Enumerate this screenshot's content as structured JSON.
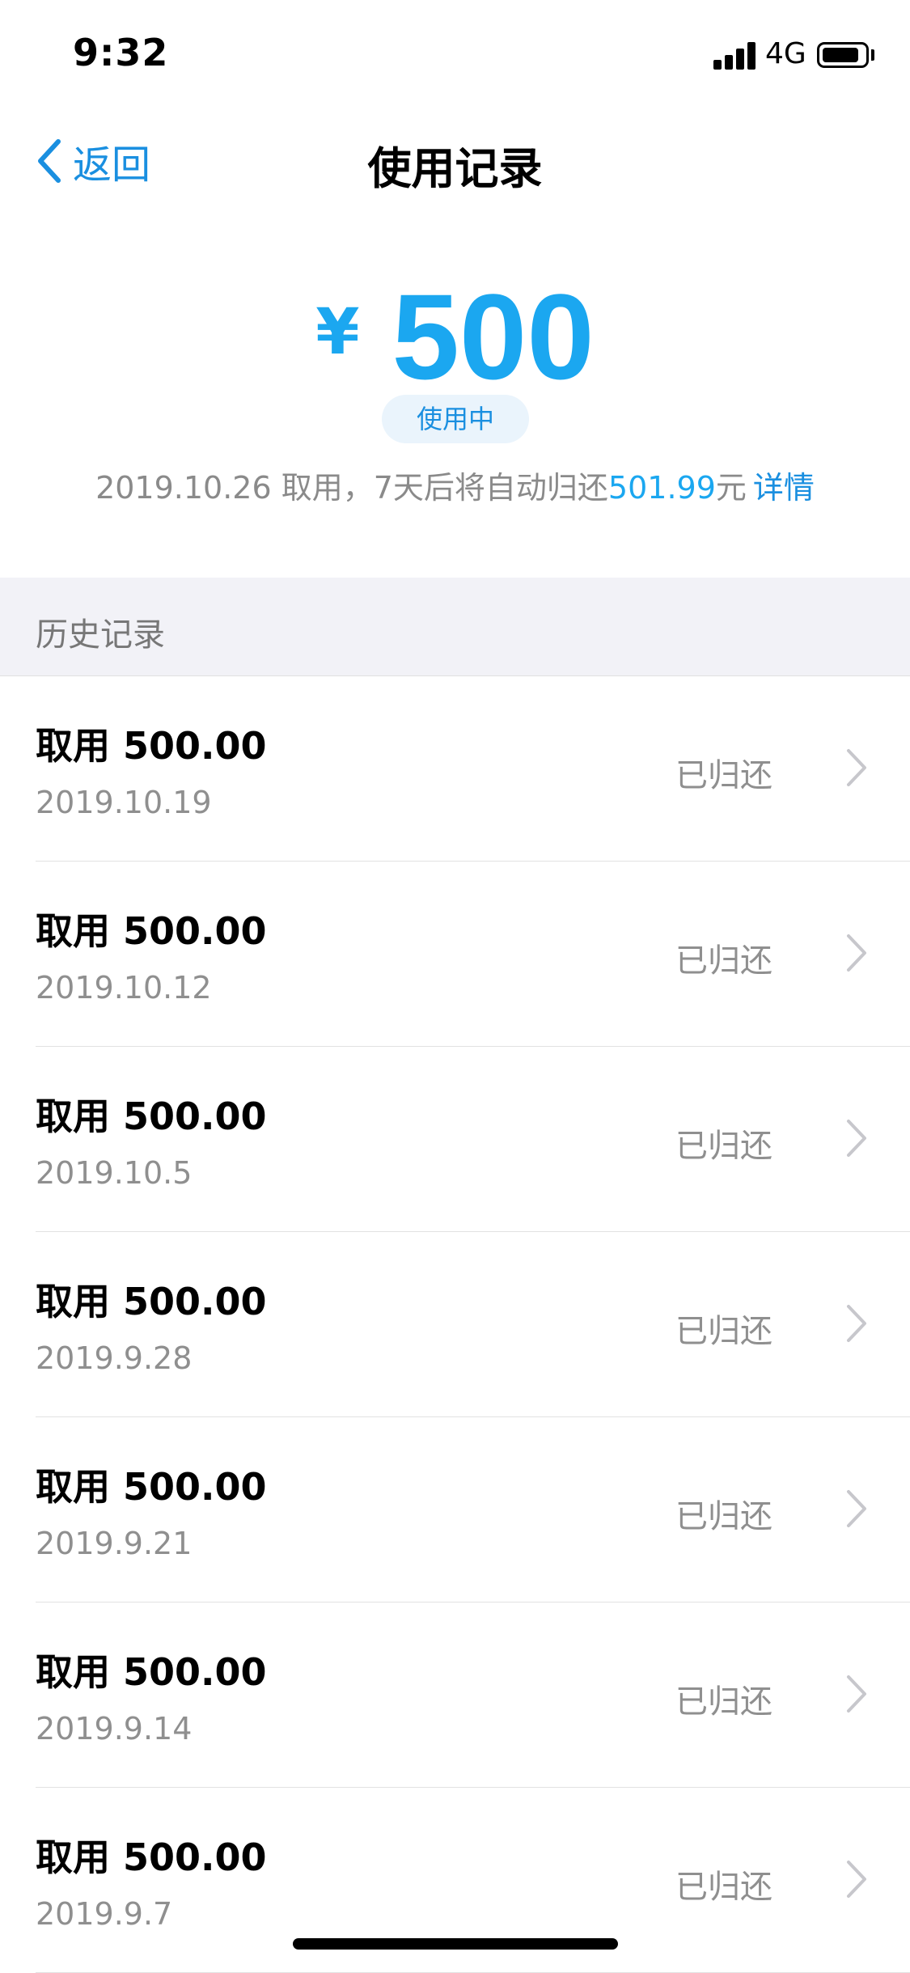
{
  "status_bar": {
    "time": "9:32",
    "network": "4G"
  },
  "nav": {
    "back_label": "返回",
    "title": "使用记录"
  },
  "summary": {
    "currency": "¥",
    "amount": "500",
    "status": "使用中",
    "info_prefix": "2019.10.26 取用，7天后将自动归还",
    "info_amount": "501.99",
    "info_unit": "元",
    "details_link": "详情",
    "accent_color": "#1ba7f0"
  },
  "history": {
    "header": "历史记录",
    "records": [
      {
        "title": "取用 500.00",
        "date": "2019.10.19",
        "status": "已归还"
      },
      {
        "title": "取用 500.00",
        "date": "2019.10.12",
        "status": "已归还"
      },
      {
        "title": "取用 500.00",
        "date": "2019.10.5",
        "status": "已归还"
      },
      {
        "title": "取用 500.00",
        "date": "2019.9.28",
        "status": "已归还"
      },
      {
        "title": "取用 500.00",
        "date": "2019.9.21",
        "status": "已归还"
      },
      {
        "title": "取用 500.00",
        "date": "2019.9.14",
        "status": "已归还"
      },
      {
        "title": "取用 500.00",
        "date": "2019.9.7",
        "status": "已归还"
      }
    ]
  },
  "icons": {
    "back": "chevron-left-icon",
    "row_arrow": "chevron-right-icon",
    "signal": "cellular-signal-icon",
    "battery": "battery-icon"
  }
}
